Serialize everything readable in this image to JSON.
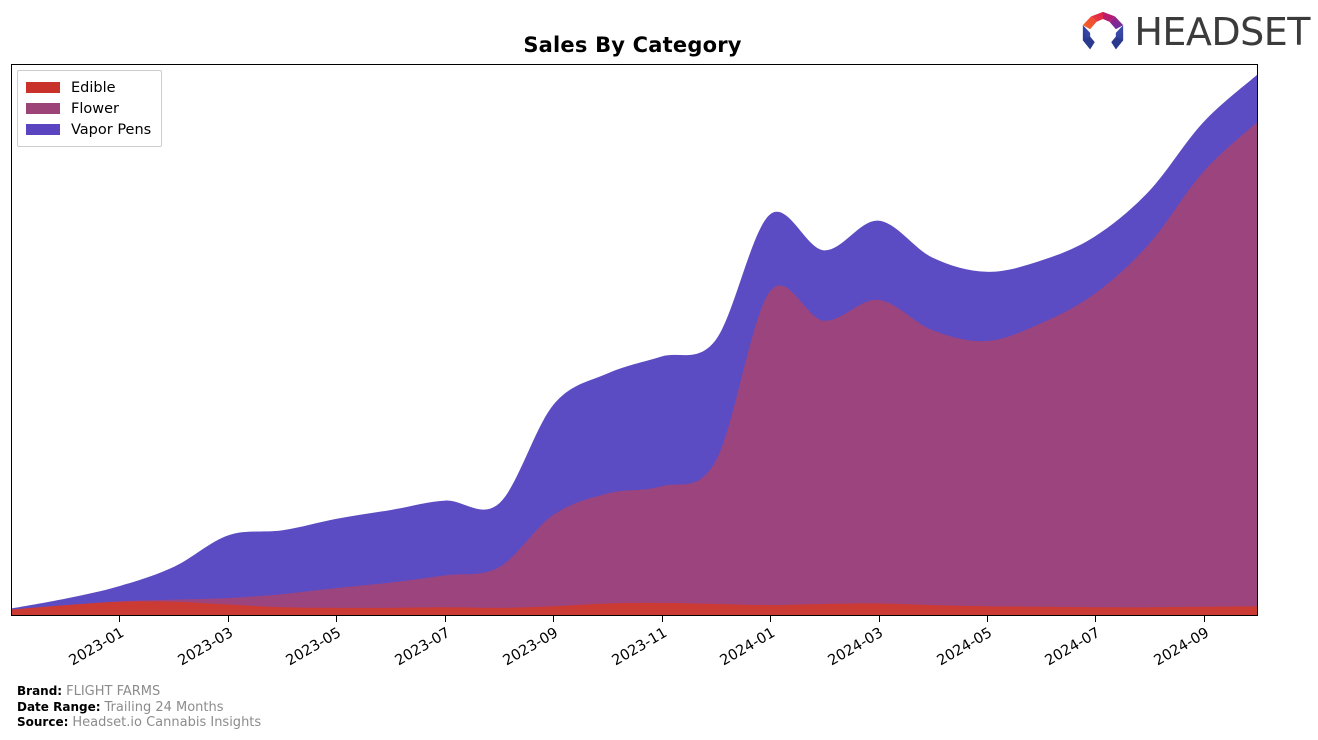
{
  "header": {
    "title": "Sales By Category",
    "logo_text": "HEADSET",
    "logo_icon": "headset-hexagon-logo"
  },
  "legend": {
    "position": "top-left",
    "items": [
      {
        "label": "Edible",
        "color": "#c8322b"
      },
      {
        "label": "Flower",
        "color": "#9c4477"
      },
      {
        "label": "Vapor Pens",
        "color": "#5b44c0"
      }
    ]
  },
  "footer": {
    "rows": [
      {
        "key": "Brand:",
        "value": "FLIGHT FARMS"
      },
      {
        "key": "Date Range:",
        "value": "Trailing 24 Months"
      },
      {
        "key": "Source:",
        "value": "Headset.io Cannabis Insights"
      }
    ]
  },
  "chart_data": {
    "type": "area",
    "stacked": true,
    "smoothing": "spline",
    "title": "Sales By Category",
    "xlabel": "",
    "ylabel": "",
    "grid": false,
    "legend_position": "top-left",
    "x": [
      "2022-11",
      "2022-12",
      "2023-01",
      "2023-02",
      "2023-03",
      "2023-04",
      "2023-05",
      "2023-06",
      "2023-07",
      "2023-08",
      "2023-09",
      "2023-10",
      "2023-11",
      "2023-12",
      "2024-01",
      "2024-02",
      "2024-03",
      "2024-04",
      "2024-05",
      "2024-06",
      "2024-07",
      "2024-08",
      "2024-09",
      "2024-10"
    ],
    "tick_labels": [
      "2023-01",
      "2023-03",
      "2023-05",
      "2023-07",
      "2023-09",
      "2023-11",
      "2024-01",
      "2024-03",
      "2024-05",
      "2024-07",
      "2024-09"
    ],
    "tick_indices": [
      2,
      4,
      6,
      8,
      10,
      12,
      14,
      16,
      18,
      20,
      22
    ],
    "ylim": [
      0,
      100
    ],
    "yaxis_visible": false,
    "series": [
      {
        "name": "Edible",
        "color": "#cc3b33",
        "values": [
          1.0,
          1.8,
          2.4,
          2.4,
          1.9,
          1.4,
          1.3,
          1.3,
          1.4,
          1.3,
          1.6,
          2.1,
          2.2,
          2.0,
          1.8,
          2.0,
          2.1,
          1.8,
          1.6,
          1.5,
          1.4,
          1.4,
          1.5,
          1.6
        ]
      },
      {
        "name": "Flower",
        "color": "#9c447e",
        "values": [
          0.0,
          0.0,
          0.1,
          0.4,
          1.2,
          2.4,
          3.6,
          4.6,
          5.8,
          7.4,
          16.6,
          20.0,
          21.2,
          26.0,
          57.0,
          51.5,
          55.2,
          50.0,
          48.2,
          51.5,
          57.0,
          66.0,
          79.0,
          88.0
        ]
      },
      {
        "name": "Vapor Pens",
        "color": "#5b4cc4",
        "values": [
          0.2,
          1.2,
          2.8,
          6.0,
          11.4,
          11.6,
          12.6,
          13.2,
          13.6,
          11.6,
          20.0,
          21.8,
          23.6,
          22.0,
          14.0,
          12.8,
          14.4,
          13.2,
          12.6,
          11.4,
          10.4,
          9.6,
          9.0,
          8.6
        ]
      }
    ]
  }
}
